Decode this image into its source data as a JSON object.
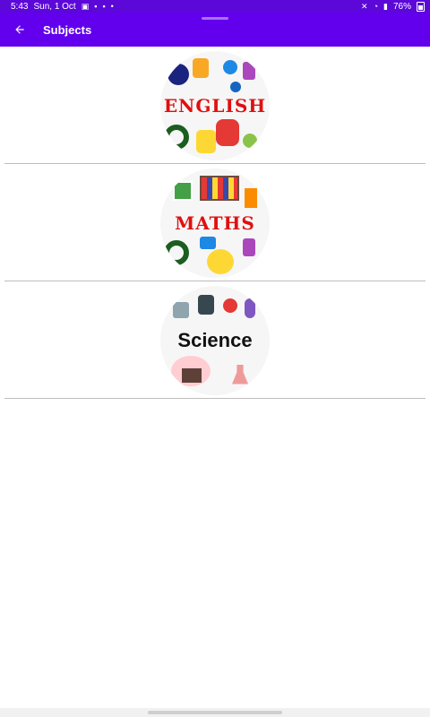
{
  "status_bar": {
    "time": "5:43",
    "date": "Sun, 1 Oct",
    "battery": "76%"
  },
  "app_bar": {
    "title": "Subjects",
    "back_icon": "arrow-left-icon",
    "color": "#6200ee"
  },
  "subjects": [
    {
      "label": "ENGLISH",
      "icon": "english-subject-image",
      "title_color": "#e01010"
    },
    {
      "label": "MATHS",
      "icon": "maths-subject-image",
      "title_color": "#e01010"
    },
    {
      "label": "Science",
      "icon": "science-subject-image",
      "title_color": "#111111"
    }
  ]
}
